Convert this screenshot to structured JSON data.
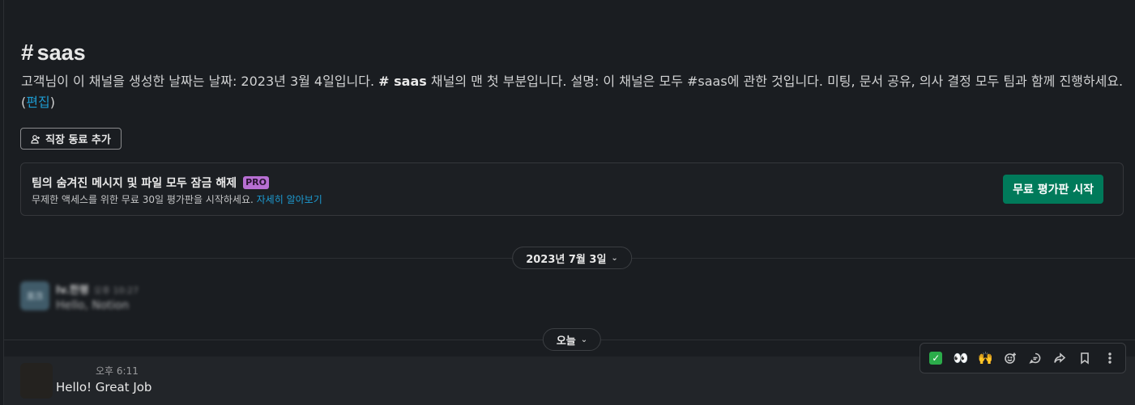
{
  "channel": {
    "hash": "#",
    "name": "saas",
    "intro_part1": "고객님이 이 채널을 생성한 날짜는 날짜: 2023년 3월 4일입니다. ",
    "intro_channel": "# saas",
    "intro_part2": " 채널의 맨 첫 부분입니다. 설명: 이 채널은 모두 #saas에 관한 것입니다. 미팅, 문서 공유, 의사 결정 모두 팀과 함께 진행하세요. (",
    "edit_link": "편집",
    "intro_close": ")"
  },
  "add_colleague_label": "직장 동료 추가",
  "promo": {
    "title": "팀의 숨겨진 메시지 및 파일 모두 잠금 해제",
    "badge": "PRO",
    "subtitle": "무제한 액세스를 위한 무료 30일 평가판을 시작하세요. ",
    "learn_more": "자세히 알아보기",
    "cta": "무료 평가판 시작"
  },
  "dividers": [
    {
      "label": "2023년 7월 3일"
    },
    {
      "label": "오늘"
    }
  ],
  "blurred_message": {
    "avatar_text": "포크",
    "author": "lv.한평",
    "time": "오후 10:27",
    "text": "Hello, Notion"
  },
  "message": {
    "time": "오후 6:11",
    "text": "Hello! Great Job"
  },
  "toolbar": {
    "icons": [
      "check-icon",
      "eyes-icon",
      "raised-hands-icon",
      "add-reaction-icon",
      "reply-in-thread-icon",
      "forward-icon",
      "bookmark-icon",
      "more-actions-icon"
    ],
    "eyes": "👀",
    "hands": "🙌"
  },
  "colors": {
    "background": "#1a1d21",
    "accent_green": "#007a5a",
    "link": "#1d9bd1",
    "pro_badge": "#b76fd3"
  }
}
